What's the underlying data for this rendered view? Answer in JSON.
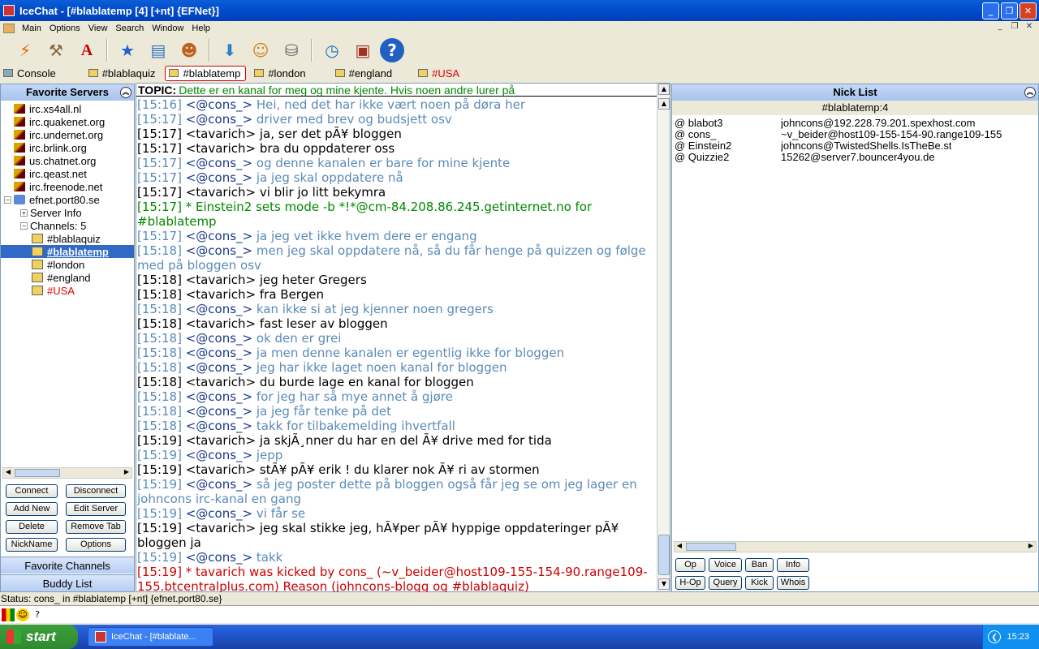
{
  "window": {
    "title": "IceChat - [#blablatemp [4] [+nt] {EFNet}]"
  },
  "menu": [
    "Main",
    "Options",
    "View",
    "Search",
    "Window",
    "Help"
  ],
  "tabs": [
    {
      "label": "Console",
      "active": false,
      "red": false
    },
    {
      "label": "#blablaquiz",
      "active": false,
      "red": false
    },
    {
      "label": "#blablatemp",
      "active": true,
      "red": false
    },
    {
      "label": "#london",
      "active": false,
      "red": false
    },
    {
      "label": "#england",
      "active": false,
      "red": false
    },
    {
      "label": "#USA",
      "active": false,
      "red": true
    }
  ],
  "left": {
    "header": "Favorite Servers",
    "servers": [
      "irc.xs4all.nl",
      "irc.quakenet.org",
      "irc.undernet.org",
      "irc.brlink.org",
      "us.chatnet.org",
      "irc.qeast.net",
      "irc.freenode.net"
    ],
    "network": "efnet.port80.se",
    "server_info": "Server Info",
    "channels_label": "Channels: 5",
    "channels": [
      "#blablaquiz",
      "#blablatemp",
      "#london",
      "#england",
      "#USA"
    ],
    "buttons": [
      "Connect",
      "Disconnect",
      "Add New",
      "Edit Server",
      "Delete",
      "Remove Tab",
      "NickName",
      "Options"
    ],
    "favorite_channels": "Favorite Channels",
    "buddy_list": "Buddy List"
  },
  "topic": {
    "label": "TOPIC:",
    "text": "Dette er en kanal for meg og mine kjente. Hvis noen andre lurer på"
  },
  "chat": [
    {
      "type": "c",
      "time": "[15:16]",
      "nick": "<@cons_>",
      "text": "Hei, ned det har ikke vært noen på døra her"
    },
    {
      "type": "c",
      "time": "[15:17]",
      "nick": "<@cons_>",
      "text": "driver med brev og budsjett osv"
    },
    {
      "type": "t",
      "time": "[15:17]",
      "nick": "<tavarich>",
      "text": "ja, ser det pÃ¥ bloggen"
    },
    {
      "type": "t",
      "time": "[15:17]",
      "nick": "<tavarich>",
      "text": "bra du oppdaterer oss"
    },
    {
      "type": "c",
      "time": "[15:17]",
      "nick": "<@cons_>",
      "text": "og denne kanalen er bare for mine kjente"
    },
    {
      "type": "c",
      "time": "[15:17]",
      "nick": "<@cons_>",
      "text": "ja jeg skal oppdatere nå"
    },
    {
      "type": "t",
      "time": "[15:17]",
      "nick": "<tavarich>",
      "text": "vi blir jo litt bekymra"
    },
    {
      "type": "m",
      "time": "[15:17]",
      "nick": "*",
      "text": "Einstein2 sets mode -b *!*@cm-84.208.86.245.getinternet.no for #blablatemp"
    },
    {
      "type": "c",
      "time": "[15:17]",
      "nick": "<@cons_>",
      "text": "ja jeg vet ikke hvem dere er engang"
    },
    {
      "type": "c",
      "time": "[15:18]",
      "nick": "<@cons_>",
      "text": "men jeg skal oppdatere nå, så du får henge på quizzen og følge med på bloggen osv"
    },
    {
      "type": "t",
      "time": "[15:18]",
      "nick": "<tavarich>",
      "text": "jeg heter Gregers"
    },
    {
      "type": "t",
      "time": "[15:18]",
      "nick": "<tavarich>",
      "text": "fra Bergen"
    },
    {
      "type": "c",
      "time": "[15:18]",
      "nick": "<@cons_>",
      "text": "kan ikke si at jeg kjenner noen gregers"
    },
    {
      "type": "t",
      "time": "[15:18]",
      "nick": "<tavarich>",
      "text": "fast leser av bloggen"
    },
    {
      "type": "c",
      "time": "[15:18]",
      "nick": "<@cons_>",
      "text": "ok den er grei"
    },
    {
      "type": "c",
      "time": "[15:18]",
      "nick": "<@cons_>",
      "text": "ja men denne kanalen er egentlig ikke for bloggen"
    },
    {
      "type": "c",
      "time": "[15:18]",
      "nick": "<@cons_>",
      "text": "jeg har ikke laget noen kanal for bloggen"
    },
    {
      "type": "t",
      "time": "[15:18]",
      "nick": "<tavarich>",
      "text": "du burde lage en kanal for bloggen"
    },
    {
      "type": "c",
      "time": "[15:18]",
      "nick": "<@cons_>",
      "text": "for jeg har så mye annet å gjøre"
    },
    {
      "type": "c",
      "time": "[15:18]",
      "nick": "<@cons_>",
      "text": "ja jeg får tenke på det"
    },
    {
      "type": "c",
      "time": "[15:18]",
      "nick": "<@cons_>",
      "text": "takk for tilbakemelding ihvertfall"
    },
    {
      "type": "t",
      "time": "[15:19]",
      "nick": "<tavarich>",
      "text": "ja skjÃ¸nner du har en del Ã¥ drive med for tida"
    },
    {
      "type": "c",
      "time": "[15:19]",
      "nick": "<@cons_>",
      "text": "jepp"
    },
    {
      "type": "t",
      "time": "[15:19]",
      "nick": "<tavarich>",
      "text": "stÃ¥ pÃ¥ erik ! du klarer nok Ã¥ ri av stormen"
    },
    {
      "type": "c",
      "time": "[15:19]",
      "nick": "<@cons_>",
      "text": "så jeg poster dette på bloggen også får jeg se om jeg lager en johncons irc-kanal en gang"
    },
    {
      "type": "c",
      "time": "[15:19]",
      "nick": "<@cons_>",
      "text": "vi får se"
    },
    {
      "type": "t",
      "time": "[15:19]",
      "nick": "<tavarich>",
      "text": "jeg skal stikke jeg, hÃ¥per pÃ¥ hyppige oppdateringer pÃ¥ bloggen ja"
    },
    {
      "type": "c",
      "time": "[15:19]",
      "nick": "<@cons_>",
      "text": "takk"
    },
    {
      "type": "k",
      "time": "[15:19]",
      "nick": "*",
      "text": "tavarich was kicked by cons_ (~v_beider@host109-155-154-90.range109-155.btcentralplus.com) Reason (johncons-blogg og #blablaquiz)"
    }
  ],
  "nicklist": {
    "header": "Nick List",
    "channel": "#blablatemp:4",
    "nicks": [
      {
        "nick": "@ blabot3",
        "host": "johncons@192.228.79.201.spexhost.com"
      },
      {
        "nick": "@ cons_",
        "host": "~v_beider@host109-155-154-90.range109-155"
      },
      {
        "nick": "@ Einstein2",
        "host": "johncons@TwistedShells.IsTheBe.st"
      },
      {
        "nick": "@ Quizzie2",
        "host": "15262@server7.bouncer4you.de"
      }
    ],
    "buttons": [
      "Op",
      "Voice",
      "Ban",
      "Info",
      "H-Op",
      "Query",
      "Kick",
      "Whois"
    ]
  },
  "status": "Status: cons_ in #blablatemp [+nt] {efnet.port80.se}",
  "input": {
    "value": "",
    "help": "?"
  },
  "taskbar": {
    "start": "start",
    "item": "IceChat - [#blablate...",
    "clock": "15:23"
  }
}
